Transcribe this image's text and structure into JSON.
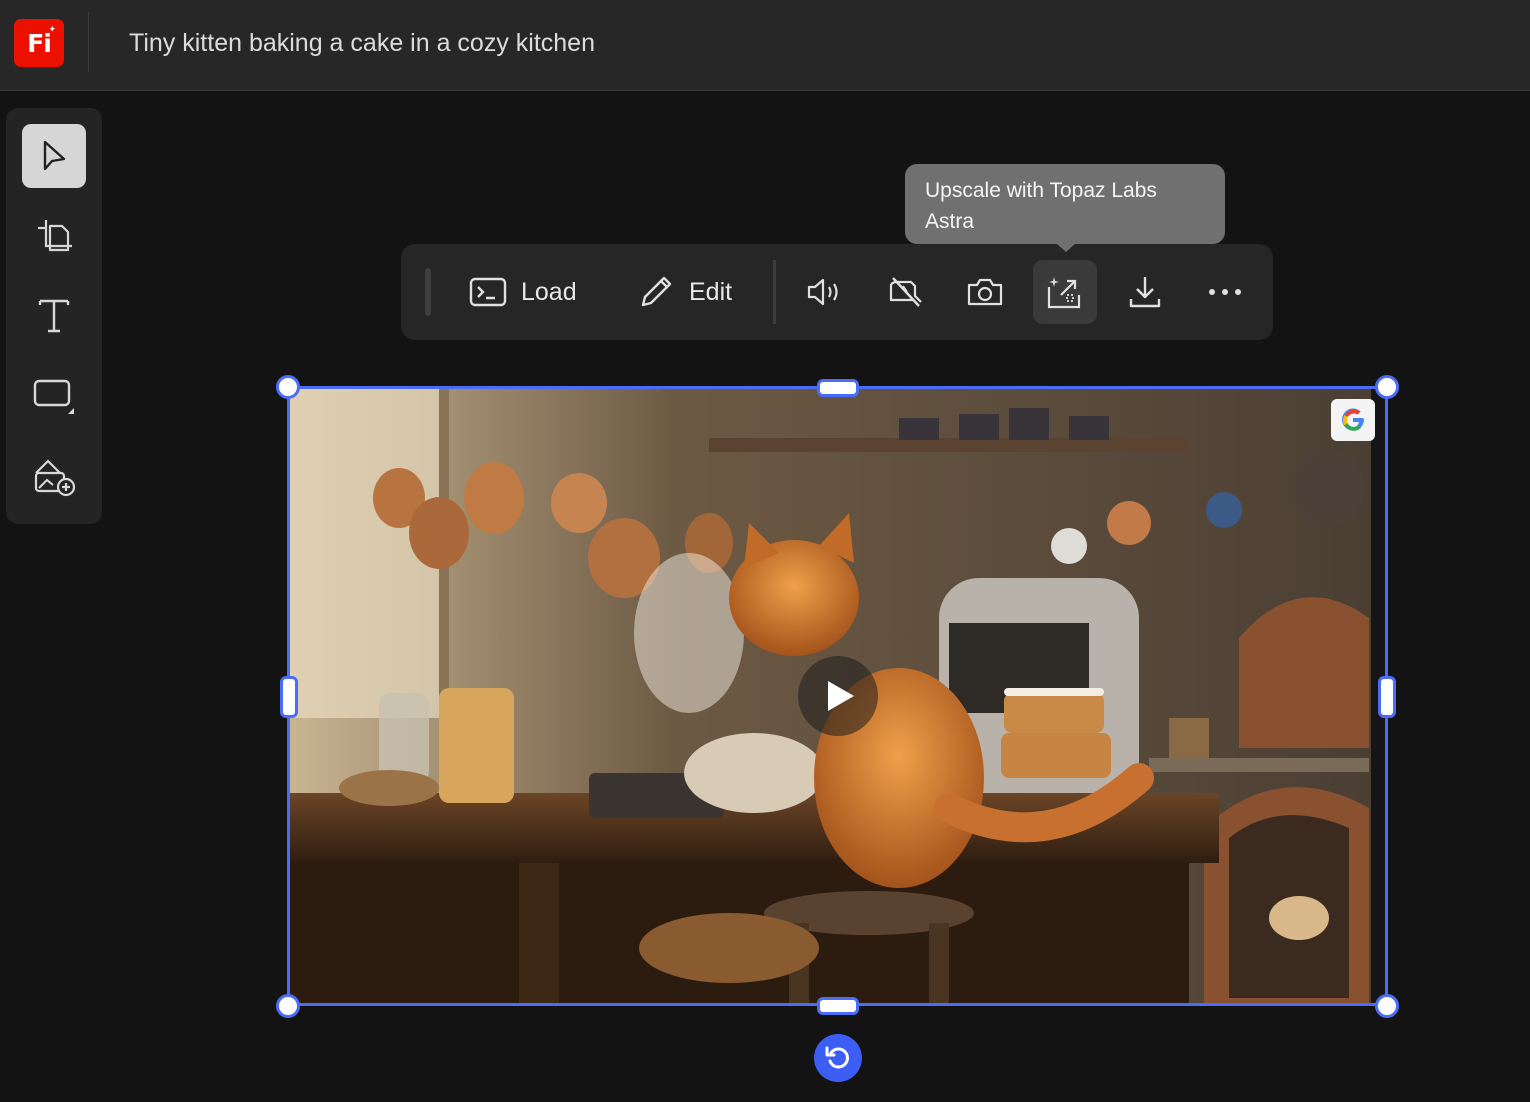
{
  "header": {
    "logo_text": "Fi",
    "title": "Tiny kitten baking a cake in a cozy kitchen"
  },
  "toolbar": {
    "tools": [
      "select-tool",
      "crop-tool",
      "text-tool",
      "shape-tool",
      "add-image-tool"
    ],
    "active": "select-tool"
  },
  "actionbar": {
    "load_label": "Load",
    "edit_label": "Edit",
    "icons": [
      "audio-icon",
      "mute-icon",
      "snapshot-icon",
      "upscale-icon",
      "download-icon",
      "more-icon"
    ]
  },
  "tooltip": {
    "text": "Upscale with Topaz Labs Astra"
  },
  "colors": {
    "accent": "#4a6cf7",
    "logo": "#eb1000",
    "background": "#131313"
  }
}
